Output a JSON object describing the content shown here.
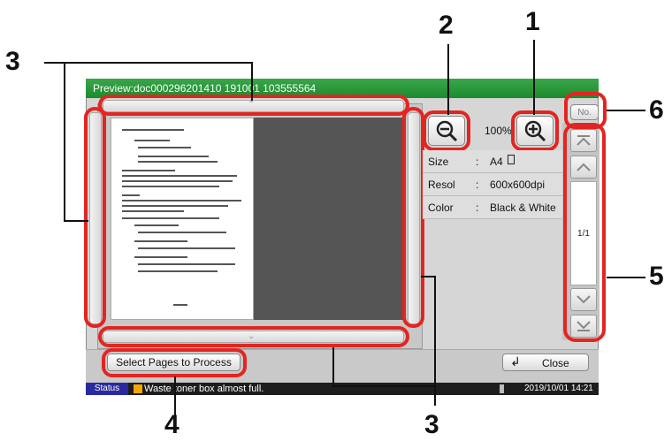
{
  "window": {
    "title": "Preview:doc000296201410 191001 103555564"
  },
  "callouts": {
    "c1": "1",
    "c2": "2",
    "c3_top": "3",
    "c3_bottom": "3",
    "c4": "4",
    "c5": "5",
    "c6": "6"
  },
  "zoom": {
    "level": "100%",
    "zoom_out_icon": "zoom-out-icon",
    "zoom_in_icon": "zoom-in-icon"
  },
  "info": {
    "size_label": "Size",
    "size_sep": ":",
    "size_value": "A4",
    "resolution_label": "Resol",
    "resolution_sep": ":",
    "resolution_value": "600x600dpi",
    "color_label": "Color",
    "color_sep": ":",
    "color_value": "Black & White"
  },
  "nav": {
    "no_label": "No.",
    "page_indicator": "1/1"
  },
  "buttons": {
    "select_pages": "Select Pages to Process",
    "close": "Close"
  },
  "status": {
    "status_label": "Status",
    "message": "Waste toner box almost full.",
    "datetime": "2019/10/01  14:21"
  },
  "colors": {
    "callout_ring": "#e32521",
    "titlebar": "#2a9a3c",
    "status_bg": "#1d1d1d",
    "status_tab": "#2a2aa0"
  }
}
